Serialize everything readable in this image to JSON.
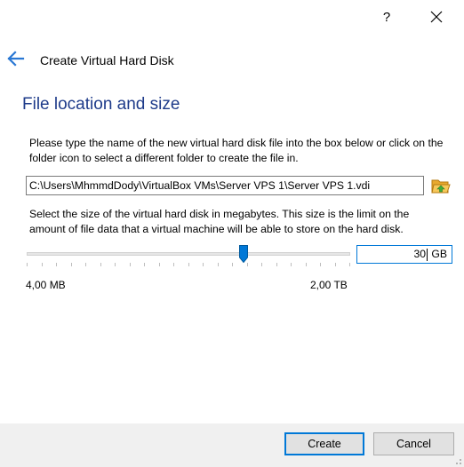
{
  "titlebar": {
    "help_label": "?",
    "close_label": "✕"
  },
  "wizard": {
    "title": "Create Virtual Hard Disk"
  },
  "page": {
    "heading": "File location and size",
    "location_description": "Please type the name of the new virtual hard disk file into the box below or click on the folder icon to select a different folder to create the file in.",
    "file_path": "C:\\Users\\MhmmdDody\\VirtualBox VMs\\Server VPS 1\\Server VPS 1.vdi",
    "size_description": "Select the size of the virtual hard disk in megabytes. This size is the limit on the amount of file data that a virtual machine will be able to store on the hard disk.",
    "size": {
      "value": "30",
      "unit": "GB",
      "min_label": "4,00 MB",
      "max_label": "2,00 TB",
      "slider_fraction": 0.67
    }
  },
  "buttons": {
    "create": "Create",
    "cancel": "Cancel"
  },
  "colors": {
    "heading": "#1e3b8a",
    "accent": "#0078d7",
    "footer": "#f0f0f0"
  },
  "icons": {
    "back": "arrow-left-icon",
    "folder": "folder-open-icon"
  }
}
